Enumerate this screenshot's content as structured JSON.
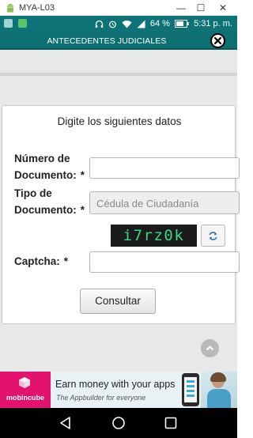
{
  "window": {
    "title": "MYA-L03",
    "minimize_label": "—",
    "maximize_label": "☐",
    "close_label": "✕"
  },
  "status_bar": {
    "battery": "64 %",
    "time": "5:31 p. m."
  },
  "header": {
    "title": "ANTECEDENTES JUDICIALES"
  },
  "form": {
    "heading": "Digite los siguientes datos",
    "documento_numero": {
      "label_line1": "Número de",
      "label_line2": "Documento:",
      "required": "*",
      "value": ""
    },
    "tipo_documento": {
      "label_line1": "Tipo de",
      "label_line2": "Documento:",
      "required": "*",
      "selected": "Cédula de Ciudadanía"
    },
    "captcha": {
      "image_text": "i7rz0k",
      "label": "Captcha:",
      "required": "*",
      "value": ""
    },
    "submit_label": "Consultar"
  },
  "ad": {
    "brand": "mobincube",
    "headline": "Earn money with your apps",
    "subline": "The Appbuilder for everyone"
  },
  "colors": {
    "status_bar": "#0d7376",
    "header": "#0d6f71",
    "ad_brand": "#e3126e",
    "captcha_text": "#34d98a"
  }
}
